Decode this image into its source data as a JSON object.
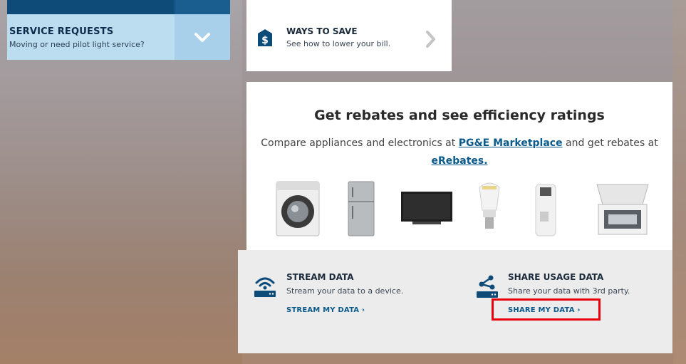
{
  "service_requests": {
    "title": "SERVICE REQUESTS",
    "subtitle": "Moving or need pilot light service?",
    "toggle_icon": "chevron-down-icon"
  },
  "ways_to_save": {
    "title": "WAYS TO SAVE",
    "subtitle": "See how to lower your bill.",
    "icon": "dollar-icon",
    "arrow_icon": "chevron-right-icon"
  },
  "rebates": {
    "title": "Get rebates and see efficiency ratings",
    "text_before": "Compare appliances and electronics at ",
    "marketplace_link": "PG&E Marketplace",
    "text_after": " and get rebates at",
    "erebates_link": "eRebates.",
    "appliances": [
      "washing-machine",
      "refrigerator",
      "television",
      "light-bulb",
      "water-heater",
      "chest-freezer"
    ]
  },
  "stream_data": {
    "title": "STREAM DATA",
    "subtitle": "Stream your data to a device.",
    "link": "STREAM MY DATA  ›",
    "icon": "wifi-router-icon"
  },
  "share_data": {
    "title": "SHARE USAGE DATA",
    "subtitle": "Share your data with 3rd party.",
    "link": "SHARE MY DATA  ›",
    "icon": "share-network-icon"
  },
  "colors": {
    "brand_blue": "#0b5a8c",
    "highlight": "#e8000b"
  }
}
